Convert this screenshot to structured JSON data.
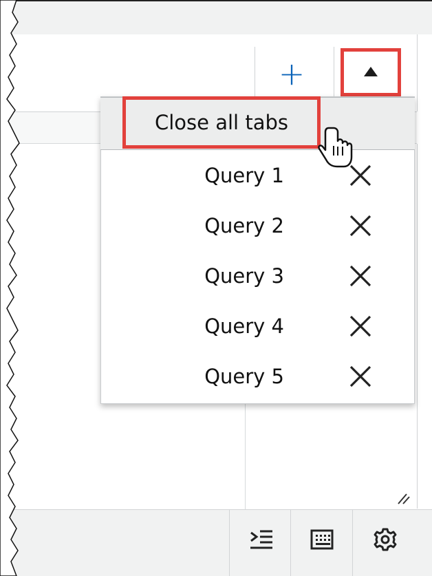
{
  "header": {
    "add_tab_symbol": "+",
    "add_tab_icon": "plus-icon",
    "collapse_icon": "caret-up-icon"
  },
  "dropdown": {
    "close_all_label": "Close all tabs",
    "items": [
      {
        "label": "Query 1"
      },
      {
        "label": "Query 2"
      },
      {
        "label": "Query 3"
      },
      {
        "label": "Query 4"
      },
      {
        "label": "Query 5"
      }
    ],
    "close_icon": "close-icon"
  },
  "toolbar": {
    "icons": [
      "indent-icon",
      "keyboard-icon",
      "gear-icon"
    ]
  },
  "colors": {
    "highlight": "#e2413c",
    "accent_blue": "#0a63b8",
    "background_gray": "#f1f2f2"
  }
}
